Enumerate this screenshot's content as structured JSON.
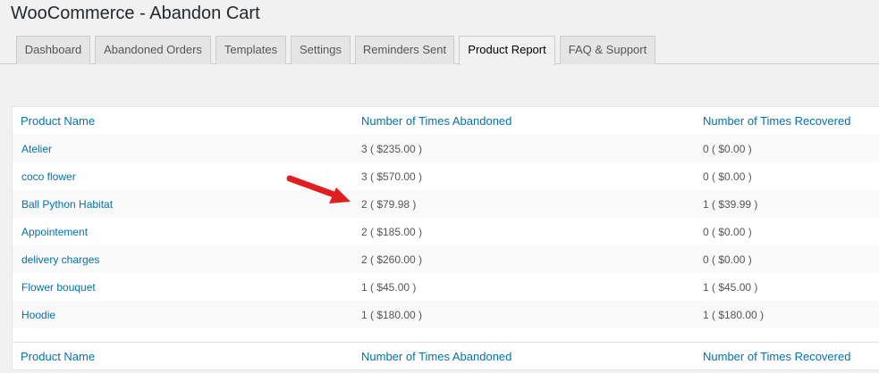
{
  "page": {
    "title": "WooCommerce - Abandon Cart"
  },
  "tabs": [
    {
      "label": "Dashboard",
      "active": false
    },
    {
      "label": "Abandoned Orders",
      "active": false
    },
    {
      "label": "Templates",
      "active": false
    },
    {
      "label": "Settings",
      "active": false
    },
    {
      "label": "Reminders Sent",
      "active": false
    },
    {
      "label": "Product Report",
      "active": true
    },
    {
      "label": "FAQ & Support",
      "active": false
    }
  ],
  "table": {
    "columns": [
      "Product Name",
      "Number of Times Abandoned",
      "Number of Times Recovered"
    ],
    "rows": [
      {
        "name": "Atelier",
        "abandoned": "3 ( $235.00 )",
        "recovered": "0 ( $0.00 )"
      },
      {
        "name": "coco flower",
        "abandoned": "3 ( $570.00 )",
        "recovered": "0 ( $0.00 )"
      },
      {
        "name": "Ball Python Habitat",
        "abandoned": "2 ( $79.98 )",
        "recovered": "1 ( $39.99 )"
      },
      {
        "name": "Appointement",
        "abandoned": "2 ( $185.00 )",
        "recovered": "0 ( $0.00 )"
      },
      {
        "name": "delivery charges",
        "abandoned": "2 ( $260.00 )",
        "recovered": "0 ( $0.00 )"
      },
      {
        "name": "Flower bouquet",
        "abandoned": "1 ( $45.00 )",
        "recovered": "1 ( $45.00 )"
      },
      {
        "name": "Hoodie",
        "abandoned": "1 ( $180.00 )",
        "recovered": "1 ( $180.00 )"
      }
    ]
  },
  "colors": {
    "link": "#0073aa",
    "arrow": "#e02020"
  }
}
